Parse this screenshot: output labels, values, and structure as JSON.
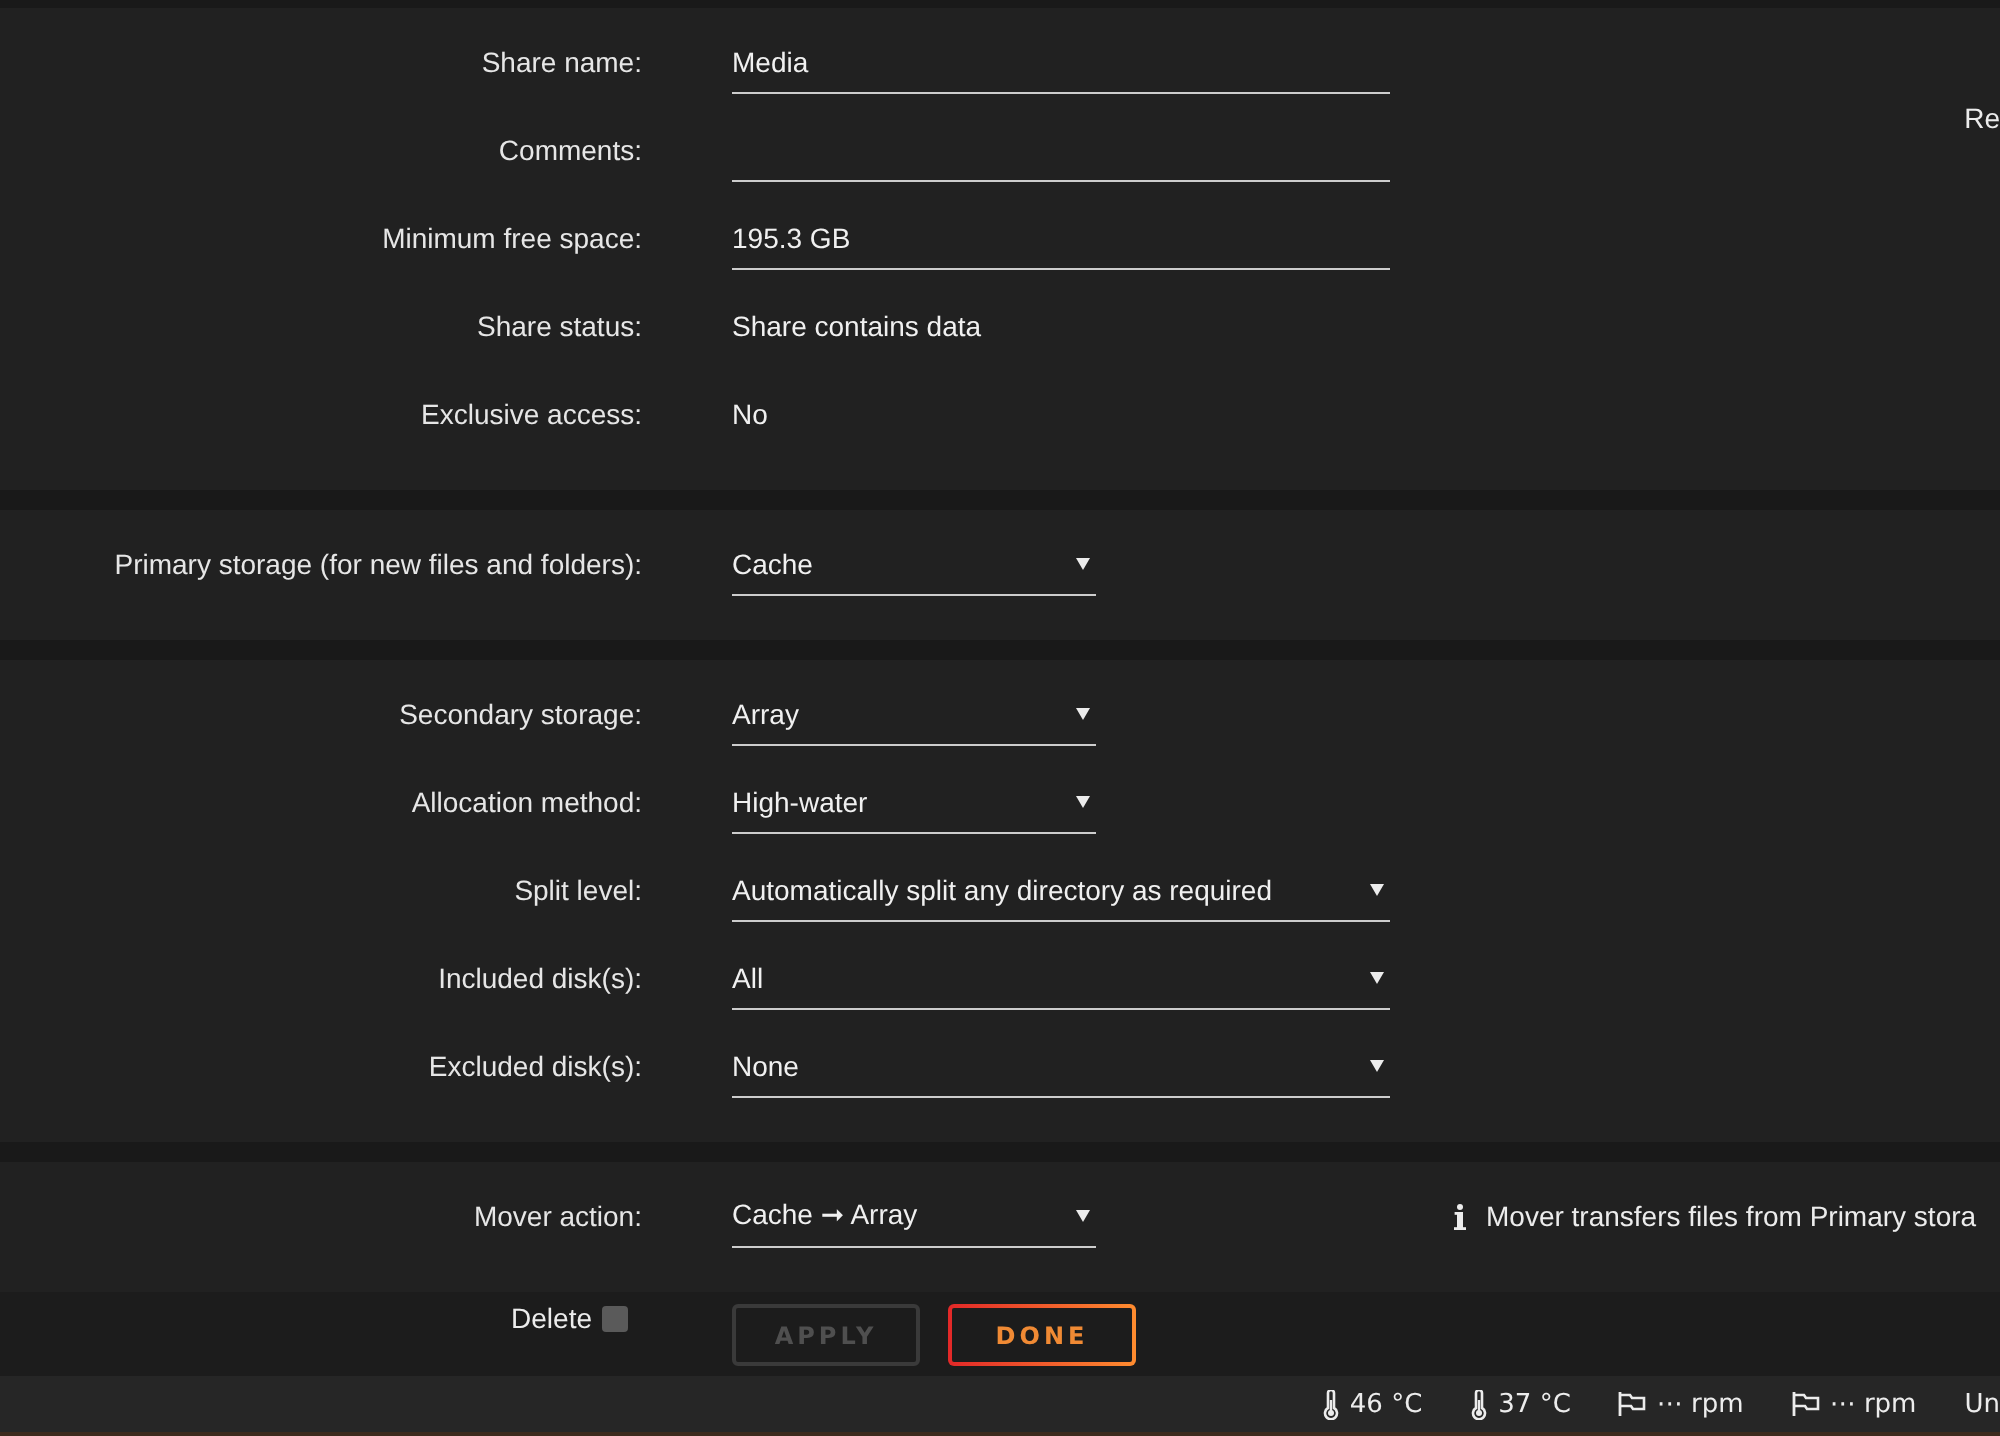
{
  "sections": [
    {
      "side_text": "Re",
      "rows": [
        {
          "kind": "input",
          "label": "Share name:",
          "value": "Media"
        },
        {
          "kind": "input",
          "label": "Comments:"
        },
        {
          "kind": "input",
          "label": "Minimum free space:",
          "value": "195.3 GB"
        },
        {
          "kind": "text",
          "label": "Share status:",
          "value": "Share contains data"
        },
        {
          "kind": "text",
          "label": "Exclusive access:",
          "value": "No"
        }
      ]
    },
    {
      "rows": [
        {
          "kind": "select",
          "label": "Primary storage (for new files and folders):",
          "value": "Cache"
        }
      ]
    },
    {
      "rows": [
        {
          "kind": "select",
          "label": "Secondary storage:",
          "value": "Array"
        },
        {
          "kind": "select",
          "label": "Allocation method:",
          "value": "High-water"
        },
        {
          "kind": "wideselect",
          "label": "Split level:",
          "value": "Automatically split any directory as required"
        },
        {
          "kind": "wideselect",
          "label": "Included disk(s):",
          "value": "All"
        },
        {
          "kind": "wideselect",
          "label": "Excluded disk(s):",
          "value": "None"
        }
      ]
    },
    {
      "rows": [
        {
          "kind": "select",
          "label": "Mover action:",
          "value": "Cache ➞ Array",
          "note": "Mover transfers files from Primary stora"
        }
      ]
    }
  ],
  "actions": {
    "delete": {
      "label": "Delete",
      "checked": false
    },
    "buttons": [
      {
        "label": "APPLY",
        "disabled": true
      },
      {
        "label": "DONE",
        "disabled": false
      }
    ]
  },
  "status_bar": [
    {
      "kind": "temp",
      "text": "46 °C"
    },
    {
      "kind": "temp",
      "text": "37 °C"
    },
    {
      "kind": "fan",
      "text": "⋯ rpm"
    },
    {
      "kind": "fan",
      "text": "⋯ rpm"
    },
    {
      "kind": "text",
      "text": "Un"
    }
  ]
}
